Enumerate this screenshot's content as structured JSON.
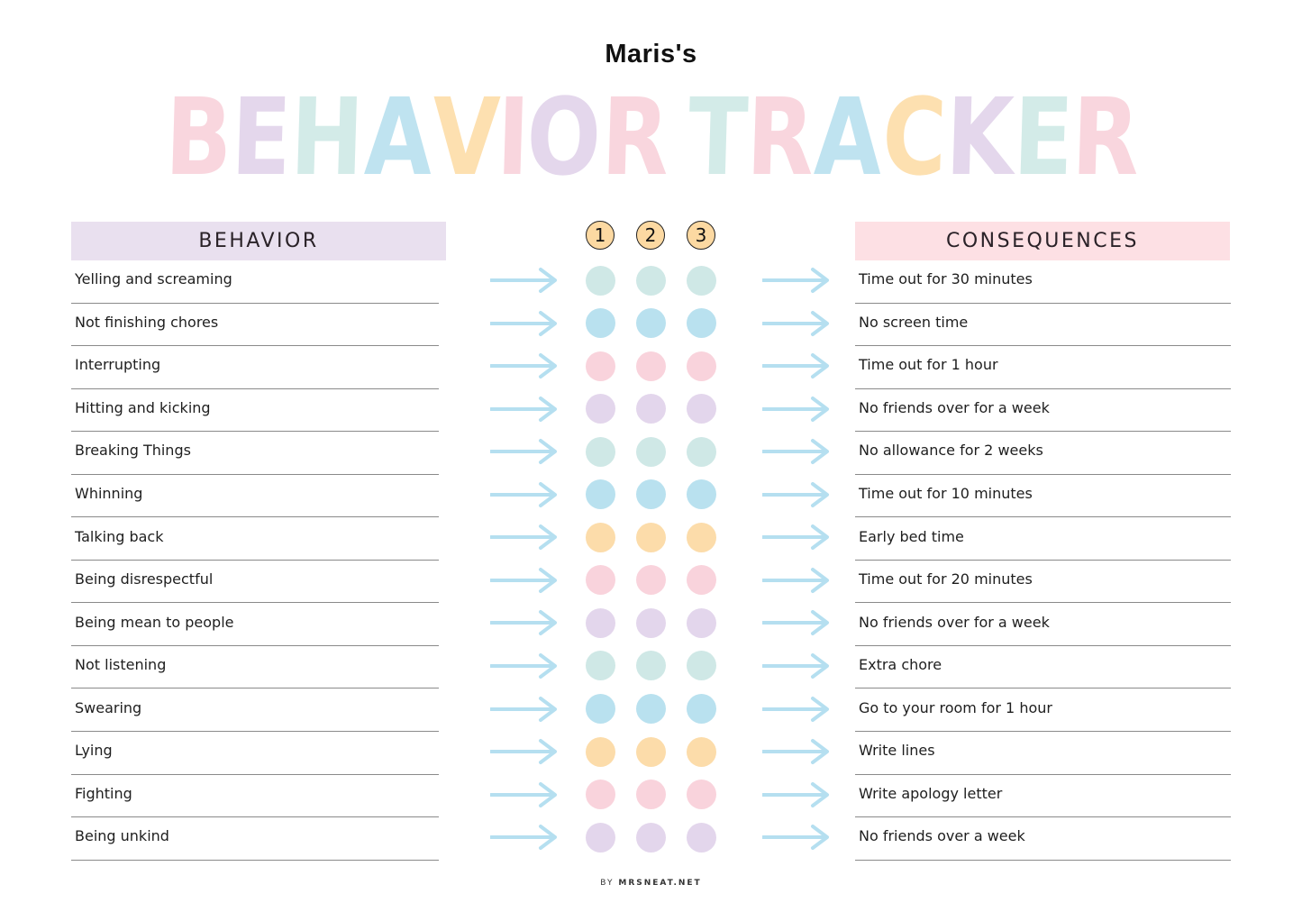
{
  "owner_name": "Maris's",
  "title": {
    "text": "BEHAVIOR TRACKER",
    "letters": [
      {
        "char": "B",
        "color": "#f9d6de"
      },
      {
        "char": "E",
        "color": "#e4d7ec"
      },
      {
        "char": "H",
        "color": "#d3ebe8"
      },
      {
        "char": "A",
        "color": "#bfe3f0"
      },
      {
        "char": "V",
        "color": "#fde0b0"
      },
      {
        "char": "I",
        "color": "#f9d6de"
      },
      {
        "char": "O",
        "color": "#e4d7ec"
      },
      {
        "char": "R",
        "color": "#f9d6de"
      },
      {
        "char": " ",
        "color": "#ffffff"
      },
      {
        "char": "T",
        "color": "#d3ebe8"
      },
      {
        "char": "R",
        "color": "#f9d6de"
      },
      {
        "char": "A",
        "color": "#bfe3f0"
      },
      {
        "char": "C",
        "color": "#fde0b0"
      },
      {
        "char": "K",
        "color": "#e4d7ec"
      },
      {
        "char": "E",
        "color": "#d3ebe8"
      },
      {
        "char": "R",
        "color": "#f9d6de"
      }
    ]
  },
  "headers": {
    "behavior": "BEHAVIOR",
    "consequences": "CONSEQUENCES"
  },
  "strike_numbers": [
    "1",
    "2",
    "3"
  ],
  "colors": {
    "mint": "#cfe8e6",
    "blue": "#b9e1ef",
    "pink": "#f9d3dc",
    "lavender": "#e3d6ec",
    "yellow": "#fcdcaa",
    "arrow": "#b5dff0",
    "behavior_header_bg": "#e9e0ef",
    "consequences_header_bg": "#fde0e4",
    "badge_bg": "#fcd9a2"
  },
  "rows": [
    {
      "behavior": "Yelling and screaming",
      "consequence": "Time out for 30 minutes",
      "dot_color": "mint",
      "marked": 0
    },
    {
      "behavior": "Not finishing chores",
      "consequence": "No screen time",
      "dot_color": "blue",
      "marked": 0
    },
    {
      "behavior": "Interrupting",
      "consequence": "Time out for 1 hour",
      "dot_color": "pink",
      "marked": 0
    },
    {
      "behavior": "Hitting and kicking",
      "consequence": "No friends over for a week",
      "dot_color": "lavender",
      "marked": 0
    },
    {
      "behavior": "Breaking Things",
      "consequence": "No allowance for 2 weeks",
      "dot_color": "mint",
      "marked": 0
    },
    {
      "behavior": "Whinning",
      "consequence": "Time out for 10 minutes",
      "dot_color": "blue",
      "marked": 0
    },
    {
      "behavior": "Talking back",
      "consequence": "Early bed time",
      "dot_color": "yellow",
      "marked": 0
    },
    {
      "behavior": "Being disrespectful",
      "consequence": "Time out for 20 minutes",
      "dot_color": "pink",
      "marked": 0
    },
    {
      "behavior": "Being mean to people",
      "consequence": "No friends over for a week",
      "dot_color": "lavender",
      "marked": 0
    },
    {
      "behavior": "Not listening",
      "consequence": "Extra chore",
      "dot_color": "mint",
      "marked": 0
    },
    {
      "behavior": "Swearing",
      "consequence": "Go to your room for 1 hour",
      "dot_color": "blue",
      "marked": 0
    },
    {
      "behavior": "Lying",
      "consequence": "Write lines",
      "dot_color": "yellow",
      "marked": 0
    },
    {
      "behavior": "Fighting",
      "consequence": "Write apology letter",
      "dot_color": "pink",
      "marked": 0
    },
    {
      "behavior": "Being unkind",
      "consequence": "No friends over a week",
      "dot_color": "lavender",
      "marked": 0
    }
  ],
  "footer": {
    "prefix": "BY",
    "brand": "MRSNEAT.NET"
  }
}
